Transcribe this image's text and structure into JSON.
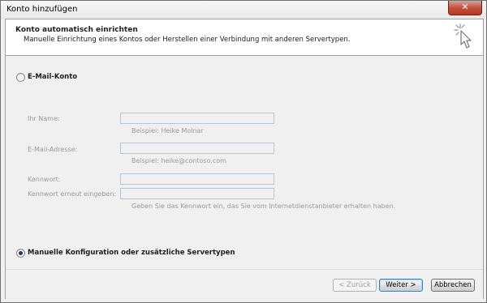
{
  "window": {
    "title": "Konto hinzufügen",
    "close_glyph": "✕"
  },
  "header": {
    "title": "Konto automatisch einrichten",
    "subtitle": "Manuelle Einrichtung eines Kontos oder Herstellen einer Verbindung mit anderen Servertypen.",
    "icon": "wizard-cursor-icon"
  },
  "form": {
    "email_option_label": "E-Mail-Konto",
    "email_option_selected": false,
    "fields": {
      "name_label": "Ihr Name:",
      "name_value": "",
      "name_hint": "Beispiel: Heike Molnar",
      "email_label": "E-Mail-Adresse:",
      "email_value": "",
      "email_hint": "Beispiel: heike@contoso.com",
      "password_label": "Kennwort:",
      "password_value": "",
      "password_confirm_label": "Kennwort erneut eingeben:",
      "password_confirm_value": "",
      "password_hint": "Geben Sie das Kennwort ein, das Sie vom Internetdienstanbieter erhalten haben."
    },
    "manual_option_label": "Manuelle Konfiguration oder zusätzliche Servertypen",
    "manual_option_selected": true
  },
  "buttons": {
    "back": "< Zurück",
    "next": "Weiter >",
    "cancel": "Abbrechen"
  },
  "colors": {
    "accent": "#3c7fb1",
    "disabled_text": "#9a9a9a",
    "close_button": "#c6523d"
  }
}
